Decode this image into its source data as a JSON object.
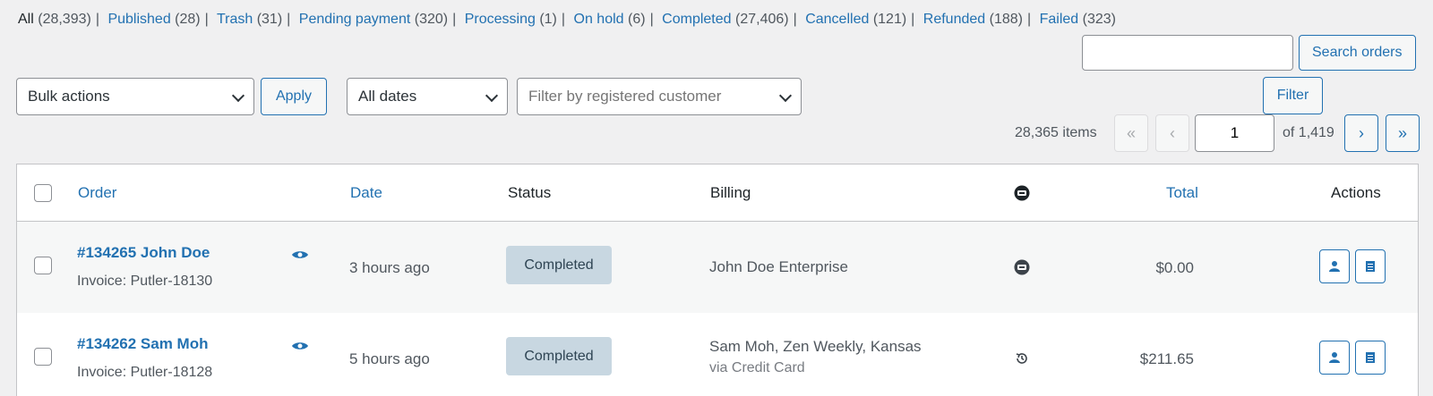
{
  "filters": {
    "views": [
      {
        "label": "All",
        "count": "(28,393)"
      },
      {
        "label": "Published",
        "count": "(28)"
      },
      {
        "label": "Trash",
        "count": "(31)"
      },
      {
        "label": "Pending payment",
        "count": "(320)"
      },
      {
        "label": "Processing",
        "count": "(1)"
      },
      {
        "label": "On hold",
        "count": "(6)"
      },
      {
        "label": "Completed",
        "count": "(27,406)"
      },
      {
        "label": "Cancelled",
        "count": "(121)"
      },
      {
        "label": "Refunded",
        "count": "(188)"
      },
      {
        "label": "Failed",
        "count": "(323)"
      }
    ],
    "separator": "|"
  },
  "search": {
    "value": "",
    "button_label": "Search orders"
  },
  "toolbar": {
    "bulk_actions": "Bulk actions",
    "apply_label": "Apply",
    "dates": "All dates",
    "customer_placeholder": "Filter by registered customer",
    "filter_label": "Filter"
  },
  "pagination": {
    "items_count": "28,365 items",
    "first": "«",
    "prev": "‹",
    "current_page": "1",
    "of_total": "of 1,419",
    "next": "›",
    "last": "»"
  },
  "table": {
    "headers": {
      "order": "Order",
      "date": "Date",
      "status": "Status",
      "billing": "Billing",
      "origin_icon": "chat-bubble-icon",
      "total": "Total",
      "actions": "Actions"
    },
    "rows": [
      {
        "order": "#134265 John Doe",
        "invoice": "Invoice: Putler-18130",
        "date": "3 hours ago",
        "status": "Completed",
        "billing": "John Doe Enterprise",
        "billing_method": "",
        "origin_icon": "chat-bubble-icon",
        "total": "$0.00"
      },
      {
        "order": "#134262 Sam Moh",
        "invoice": "Invoice: Putler-18128",
        "date": "5 hours ago",
        "status": "Completed",
        "billing": "Sam Moh, Zen Weekly, Kansas",
        "billing_method": "via Credit Card",
        "origin_icon": "history-icon",
        "total": "$211.65"
      }
    ]
  },
  "colors": {
    "accent": "#2271b1",
    "status_completed_bg": "#c8d7e1",
    "status_completed_text": "#2e4453"
  }
}
